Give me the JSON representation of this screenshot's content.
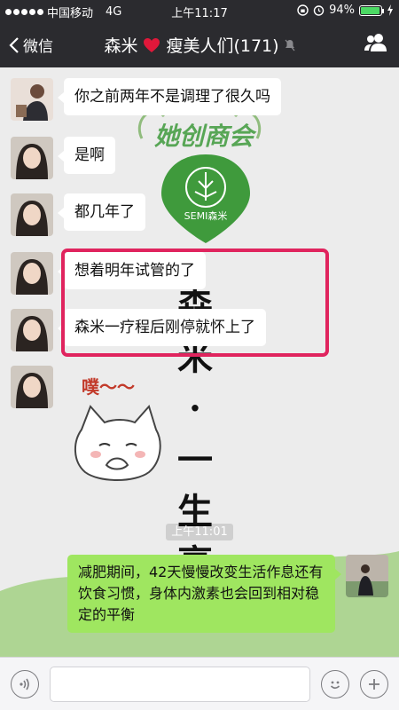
{
  "status": {
    "carrier": "中国移动",
    "network": "4G",
    "time": "上午11:17",
    "battery": "94%",
    "battery_level": 0.94
  },
  "nav": {
    "back_label": "微信",
    "title_part1": "森米",
    "title_part2": "瘦美人们(171)"
  },
  "messages": [
    {
      "text": "你之前两年不是调理了很久吗"
    },
    {
      "text": "是啊"
    },
    {
      "text": "都几年了"
    },
    {
      "text": "想着明年试管的了"
    },
    {
      "text": "森米一疗程后刚停就怀上了"
    }
  ],
  "sticker": {
    "text": "噗～～"
  },
  "watermark": {
    "top_text": "她创商会",
    "logo_text": "SEMI森米",
    "vertical_text": [
      "森",
      "米",
      "·",
      "一",
      "生",
      "享"
    ]
  },
  "time_label": "上午11:01",
  "self_message": "减肥期间，42天慢慢改变生活作息还有饮食习惯，身体内激素也会回到相对稳定的平衡",
  "colors": {
    "accent_green": "#9fe660",
    "highlight": "#e0245e",
    "nav_bg": "#2b2b2f"
  }
}
